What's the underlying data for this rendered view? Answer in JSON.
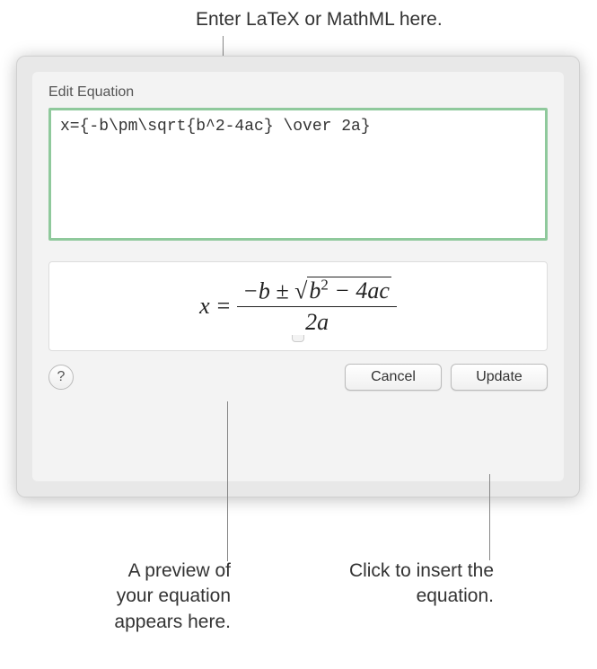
{
  "callouts": {
    "top": "Enter LaTeX or MathML here.",
    "preview": "A preview of your equation appears here.",
    "update": "Click to insert the equation."
  },
  "dialog": {
    "title": "Edit Equation",
    "input_value": "x={-b\\pm\\sqrt{b^2-4ac} \\over 2a}",
    "preview": {
      "lhs": "x",
      "equals": "=",
      "numerator_prefix": "−b ±",
      "radicand": "b",
      "radicand_exp": "2",
      "radicand_suffix": " − 4ac",
      "denominator": "2a"
    },
    "buttons": {
      "help": "?",
      "cancel": "Cancel",
      "update": "Update"
    }
  }
}
